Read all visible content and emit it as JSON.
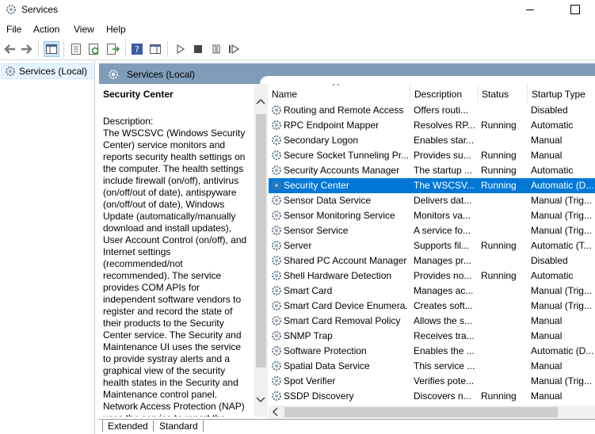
{
  "window": {
    "title": "Services",
    "icon": "gear-icon"
  },
  "menu": [
    "File",
    "Action",
    "View",
    "Help"
  ],
  "toolbar": {
    "icons": [
      "back-arrow-icon",
      "forward-arrow-icon",
      "console-tree-icon",
      "properties-icon",
      "refresh-icon",
      "export-list-icon",
      "help-icon",
      "action-pane-icon",
      "start-service-icon",
      "stop-service-icon",
      "pause-service-icon",
      "resume-service-icon"
    ]
  },
  "tree": {
    "item_label": "Services (Local)"
  },
  "main": {
    "header_title": "Services (Local)",
    "selected_service": "Security Center",
    "description_label": "Description:",
    "description_text": "The WSCSVC (Windows Security Center) service monitors and reports security health settings on the computer.  The health settings include firewall (on/off), antivirus (on/off/out of date), antispyware (on/off/out of date), Windows Update (automatically/manually download and install updates), User Account Control (on/off), and Internet settings (recommended/not recommended). The service provides COM APIs for independent software vendors to register and record the state of their products to the Security Center service.  The Security and Maintenance UI uses the service to provide systray alerts and a graphical view of the security health states in the Security and Maintenance control panel. Network Access Protection (NAP) uses the service to report the"
  },
  "columns": {
    "name": "Name",
    "description": "Description",
    "status": "Status",
    "startup": "Startup Type"
  },
  "services": [
    {
      "name": "Routing and Remote Access",
      "description": "Offers routi...",
      "status": "",
      "startup": "Disabled"
    },
    {
      "name": "RPC Endpoint Mapper",
      "description": "Resolves RP...",
      "status": "Running",
      "startup": "Automatic"
    },
    {
      "name": "Secondary Logon",
      "description": "Enables star...",
      "status": "",
      "startup": "Manual"
    },
    {
      "name": "Secure Socket Tunneling Pr...",
      "description": "Provides su...",
      "status": "Running",
      "startup": "Manual"
    },
    {
      "name": "Security Accounts Manager",
      "description": "The startup ...",
      "status": "Running",
      "startup": "Automatic"
    },
    {
      "name": "Security Center",
      "description": "The WSCSV...",
      "status": "Running",
      "startup": "Automatic (D...",
      "selected": true
    },
    {
      "name": "Sensor Data Service",
      "description": "Delivers dat...",
      "status": "",
      "startup": "Manual (Trig..."
    },
    {
      "name": "Sensor Monitoring Service",
      "description": "Monitors va...",
      "status": "",
      "startup": "Manual (Trig..."
    },
    {
      "name": "Sensor Service",
      "description": "A service fo...",
      "status": "",
      "startup": "Manual (Trig..."
    },
    {
      "name": "Server",
      "description": "Supports fil...",
      "status": "Running",
      "startup": "Automatic (T..."
    },
    {
      "name": "Shared PC Account Manager",
      "description": "Manages pr...",
      "status": "",
      "startup": "Disabled"
    },
    {
      "name": "Shell Hardware Detection",
      "description": "Provides no...",
      "status": "Running",
      "startup": "Automatic"
    },
    {
      "name": "Smart Card",
      "description": "Manages ac...",
      "status": "",
      "startup": "Manual (Trig..."
    },
    {
      "name": "Smart Card Device Enumera...",
      "description": "Creates soft...",
      "status": "",
      "startup": "Manual (Trig..."
    },
    {
      "name": "Smart Card Removal Policy",
      "description": "Allows the s...",
      "status": "",
      "startup": "Manual"
    },
    {
      "name": "SNMP Trap",
      "description": "Receives tra...",
      "status": "",
      "startup": "Manual"
    },
    {
      "name": "Software Protection",
      "description": "Enables the ...",
      "status": "",
      "startup": "Automatic (D..."
    },
    {
      "name": "Spatial Data Service",
      "description": "This service ...",
      "status": "",
      "startup": "Manual"
    },
    {
      "name": "Spot Verifier",
      "description": "Verifies pote...",
      "status": "",
      "startup": "Manual (Trig..."
    },
    {
      "name": "SSDP Discovery",
      "description": "Discovers n...",
      "status": "Running",
      "startup": "Manual"
    }
  ],
  "tabs": [
    "Extended",
    "Standard"
  ],
  "colors": {
    "selection": "#0078d7",
    "header_bar": "#7f9db9"
  }
}
